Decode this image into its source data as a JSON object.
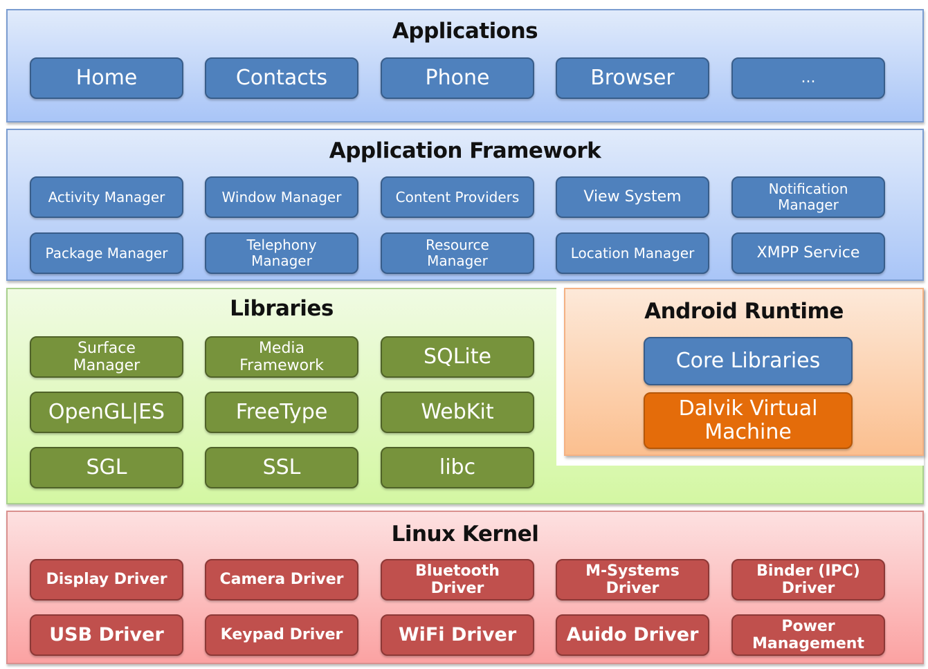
{
  "applications": {
    "title": "Applications",
    "items": [
      "Home",
      "Contacts",
      "Phone",
      "Browser",
      "..."
    ]
  },
  "framework": {
    "title": "Application Framework",
    "row1": [
      "Activity Manager",
      "Window Manager",
      "Content Providers",
      "View System",
      "Notification Manager"
    ],
    "row2": [
      "Package Manager",
      "Telephony Manager",
      "Resource Manager",
      "Location Manager",
      "XMPP Service"
    ]
  },
  "libraries": {
    "title": "Libraries",
    "row1": [
      "Surface Manager",
      "Media Framework",
      "SQLite"
    ],
    "row2": [
      "OpenGL|ES",
      "FreeType",
      "WebKit"
    ],
    "row3": [
      "SGL",
      "SSL",
      "libc"
    ]
  },
  "runtime": {
    "title": "Android Runtime",
    "core": "Core Libraries",
    "vm": "Dalvik Virtual Machine"
  },
  "kernel": {
    "title": "Linux Kernel",
    "row1": [
      "Display Driver",
      "Camera Driver",
      "Bluetooth Driver",
      "M-Systems Driver",
      "Binder (IPC) Driver"
    ],
    "row2": [
      "USB Driver",
      "Keypad Driver",
      "WiFi Driver",
      "Auido Driver",
      "Power Management"
    ]
  },
  "colors": {
    "app_blue": "#4f81bd",
    "lib_green": "#77933c",
    "kernel_red": "#c0504d",
    "vm_orange": "#e46c0a"
  }
}
